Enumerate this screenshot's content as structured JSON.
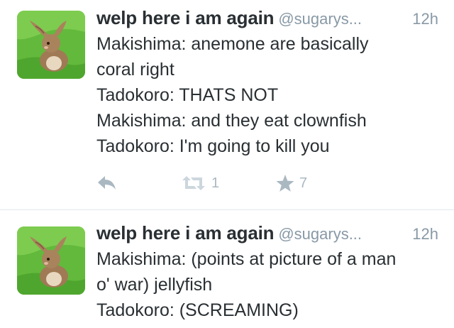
{
  "tweets": [
    {
      "display_name": "welp here i am again",
      "handle": "@sugarys...",
      "time": "12h",
      "lines": [
        "Makishima: anemone are basically",
        "coral right",
        "Tadokoro: THATS NOT",
        "Makishima: and they eat clownfish",
        "Tadokoro: I'm going to kill you"
      ],
      "retweet_count": "1",
      "favorite_count": "7",
      "icons": {
        "reply": "reply-icon",
        "retweet": "retweet-icon",
        "favorite": "star-icon"
      }
    },
    {
      "display_name": "welp here i am again",
      "handle": "@sugarys...",
      "time": "12h",
      "lines": [
        "Makishima: (points at picture of a man",
        "o' war) jellyfish",
        "Tadokoro: (SCREAMING)"
      ]
    }
  ],
  "colors": {
    "text": "#292f33",
    "muted": "#8899a6",
    "icon": "#aab8c2",
    "divider": "#e1e8ed",
    "avatar_bg": "#5fb83a"
  }
}
